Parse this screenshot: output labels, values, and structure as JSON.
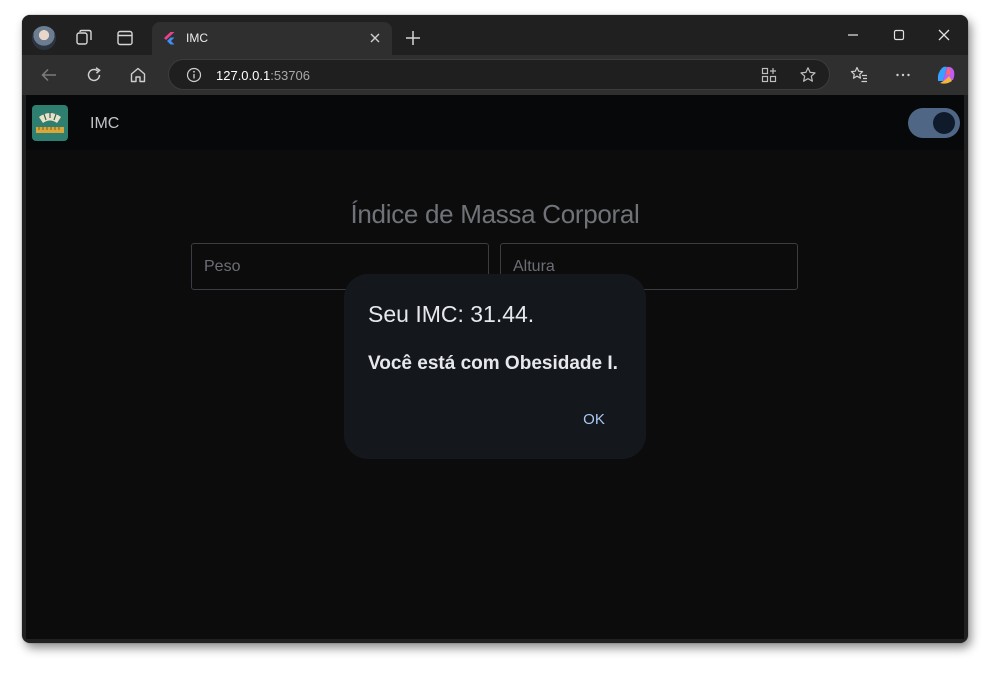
{
  "browser": {
    "tab": {
      "title": "IMC"
    },
    "address": {
      "host": "127.0.0.1",
      "port": ":53706"
    },
    "icons": {
      "profile": "avatar-icon",
      "workspaces": "workspaces-icon",
      "tab_actions": "tab-actions-icon",
      "favicon": "flutter-favicon",
      "close_tab": "close-icon",
      "new_tab": "plus-icon",
      "back": "back-arrow-icon",
      "refresh": "refresh-icon",
      "home": "home-icon",
      "info": "info-icon",
      "app_available": "app-available-icon",
      "favorite": "star-icon",
      "favorites": "favorites-icon",
      "menu": "more-icon",
      "copilot": "copilot-icon"
    }
  },
  "app": {
    "title": "IMC",
    "heading": "Índice de Massa Corporal",
    "fields": {
      "weight_placeholder": "Peso",
      "height_placeholder": "Altura"
    },
    "theme_toggle": {
      "on": true,
      "icon": "moon-icon"
    }
  },
  "dialog": {
    "title": "Seu IMC: 31.44.",
    "message": "Você está com Obesidade I.",
    "ok_label": "OK"
  },
  "colors": {
    "page_bg": "#0c0c0d",
    "dialog_bg": "#14171c",
    "accent": "#a9c8f3",
    "toggle_track": "#4f6684"
  }
}
